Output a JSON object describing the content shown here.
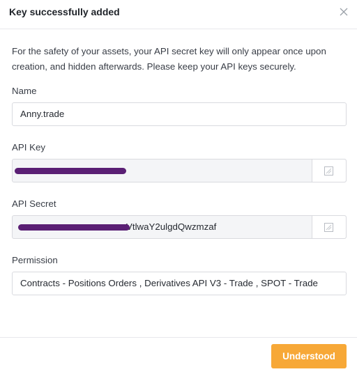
{
  "dialog": {
    "title": "Key successfully added",
    "notice": "For the safety of your assets, your API secret key will only appear once upon creation, and hidden afterwards. Please keep your API keys securely."
  },
  "fields": {
    "name": {
      "label": "Name",
      "value": "Anny.trade"
    },
    "api_key": {
      "label": "API Key",
      "value": ""
    },
    "api_secret": {
      "label": "API Secret",
      "value": "VtlwaY2ulgdQwzmzaf"
    },
    "permission": {
      "label": "Permission",
      "value": "Contracts - Positions Orders , Derivatives API V3 - Trade , SPOT - Trade"
    }
  },
  "footer": {
    "button_label": "Understood"
  },
  "icons": {
    "close": "close-icon",
    "copy": "copy-icon"
  },
  "colors": {
    "accent": "#f7a837",
    "redaction": "#5a1f74"
  }
}
